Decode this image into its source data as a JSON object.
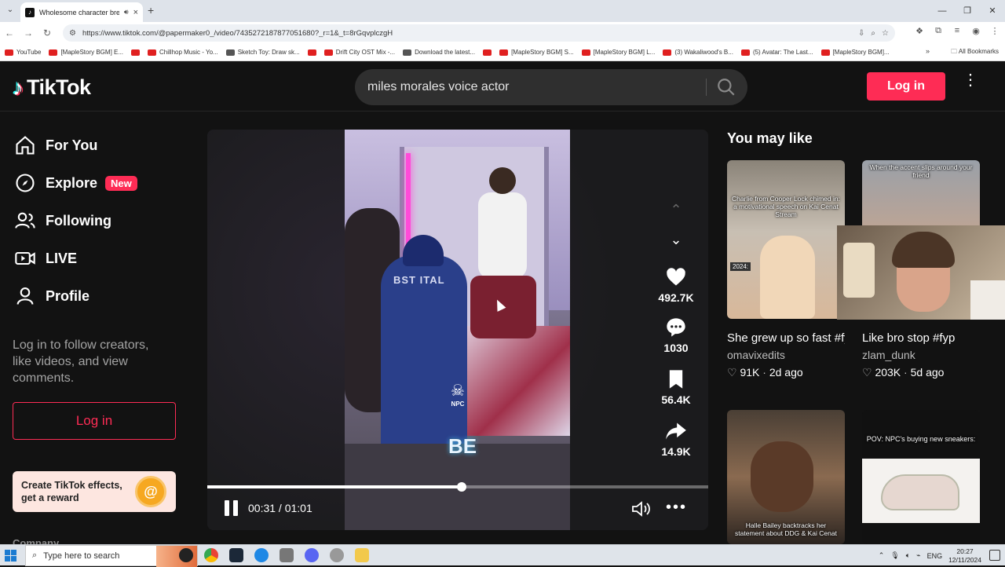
{
  "browser": {
    "tab_title": "Wholesome character break",
    "url": "https://www.tiktok.com/@papermaker0_/video/7435272187877051680?_r=1&_t=8rGqvplczgH",
    "bookmarks": [
      {
        "label": "YouTube",
        "kind": "yt"
      },
      {
        "label": "[MapleStory BGM] E...",
        "kind": "yt"
      },
      {
        "label": "",
        "kind": "yt"
      },
      {
        "label": "Chillhop Music - Yo...",
        "kind": "yt"
      },
      {
        "label": "Sketch Toy: Draw sk...",
        "kind": "other"
      },
      {
        "label": "",
        "kind": "yt"
      },
      {
        "label": "Drift City OST Mix -...",
        "kind": "yt"
      },
      {
        "label": "Download the latest...",
        "kind": "other"
      },
      {
        "label": "",
        "kind": "yt"
      },
      {
        "label": "[MapleStory BGM] S...",
        "kind": "yt"
      },
      {
        "label": "[MapleStory BGM] L...",
        "kind": "yt"
      },
      {
        "label": "(3) Wakaliwood's B...",
        "kind": "yt"
      },
      {
        "label": "(5) Avatar: The Last...",
        "kind": "yt"
      },
      {
        "label": "[MapleStory BGM]...",
        "kind": "yt"
      }
    ],
    "all_bookmarks": "All Bookmarks",
    "more_bookmarks": "»"
  },
  "header": {
    "logo_text": "TikTok",
    "search_value": "miles morales voice actor",
    "login_label": "Log in"
  },
  "sidebar": {
    "items": [
      {
        "label": "For You",
        "icon": "home-icon"
      },
      {
        "label": "Explore",
        "icon": "compass-icon",
        "badge": "New"
      },
      {
        "label": "Following",
        "icon": "users-icon"
      },
      {
        "label": "LIVE",
        "icon": "live-icon"
      },
      {
        "label": "Profile",
        "icon": "profile-icon"
      }
    ],
    "login_hint": "Log in to follow creators, like videos, and view comments.",
    "login_label": "Log in",
    "effects_banner": "Create TikTok effects, get a reward",
    "footer_label": "Company"
  },
  "video": {
    "overlay_text": "BE",
    "sticker_text": "NPC",
    "shirt_text": "BST ITAL",
    "likes": "492.7K",
    "comments": "1030",
    "saves": "56.4K",
    "shares": "14.9K",
    "time": "00:31 / 01:01",
    "progress_fraction": 0.508
  },
  "recommendations": {
    "title": "You may like",
    "cards": [
      {
        "caption": "Charlie from Cooper Lock chimed in: a motivational speech on Kai Cenat Stream",
        "title": "She grew up so fast #fyp #kai #kaicena...",
        "author": "omavixedits",
        "views": "91K",
        "age": "2d ago",
        "tag": "2024:"
      },
      {
        "caption": "When the accent slips around your friend",
        "title": "Like bro stop #fyp",
        "author": "zlam_dunk",
        "views": "203K",
        "age": "5d ago"
      },
      {
        "caption": "Halle Bailey backtracks her statement about DDG & Kai Cenat",
        "title": "",
        "author": "",
        "views": "",
        "age": ""
      },
      {
        "caption": "POV: NPC's buying new sneakers:",
        "title": "",
        "author": "",
        "views": "",
        "age": ""
      }
    ]
  },
  "taskbar": {
    "search_placeholder": "Type here to search",
    "lang": "ENG",
    "time": "20:27",
    "date": "12/11/2024"
  },
  "colors": {
    "brand_pink": "#fe2c55",
    "background": "#121212"
  }
}
